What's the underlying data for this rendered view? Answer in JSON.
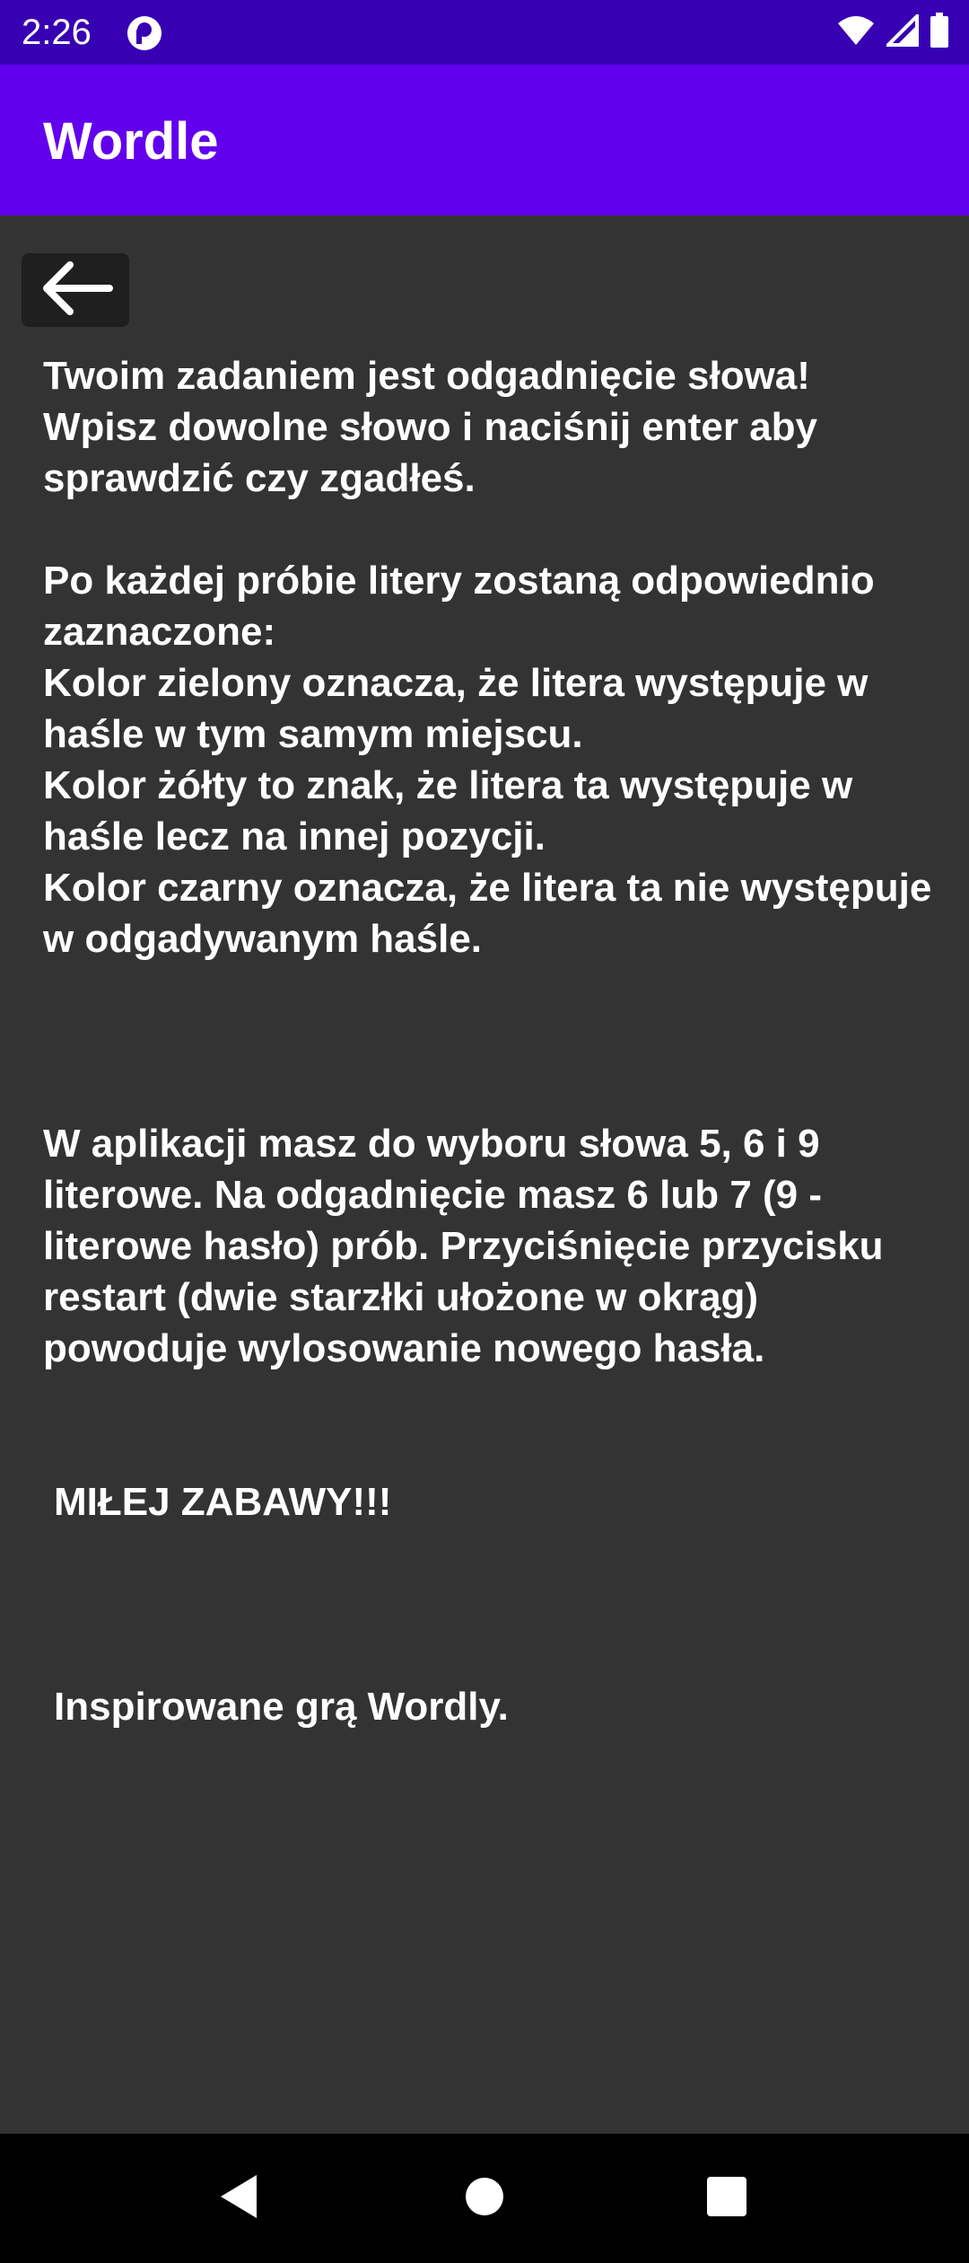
{
  "status_bar": {
    "time": "2:26",
    "app_icon": "camera-app-icon",
    "icons": [
      "wifi-icon",
      "signal-icon",
      "battery-icon"
    ],
    "background": "#3700b3"
  },
  "app_bar": {
    "title": "Wordle",
    "background": "#6200ee"
  },
  "back_button": {
    "icon": "arrow-left-icon"
  },
  "content": {
    "intro": "Twoim zadaniem jest odgadnięcie słowa!\nWpisz dowolne słowo i naciśnij enter aby sprawdzić czy zgadłeś.",
    "rules": "Po każdej próbie litery zostaną odpowiednio zaznaczone:\nKolor zielony oznacza, że litera występuje w haśle w tym samym miejscu.\nKolor żółty to znak, że litera ta występuje w haśle lecz na innej pozycji.\nKolor czarny oznacza, że litera ta nie występuje w odgadywanym haśle.",
    "app_info": "W aplikacji masz do wyboru słowa 5, 6 i 9 literowe. Na odgadnięcie masz 6 lub 7 (9 - literowe hasło) prób. Przyciśnięcie przycisku restart (dwie starzłki ułożone w okrąg) powoduje wylosowanie nowego hasła.",
    "greeting": "MIŁEJ ZABAWY!!!",
    "credits": "Inspirowane grą Wordly."
  },
  "nav_bar": {
    "buttons": [
      "back-triangle-icon",
      "home-circle-icon",
      "recents-square-icon"
    ]
  },
  "colors": {
    "background": "#333333",
    "text": "#ffffff"
  }
}
